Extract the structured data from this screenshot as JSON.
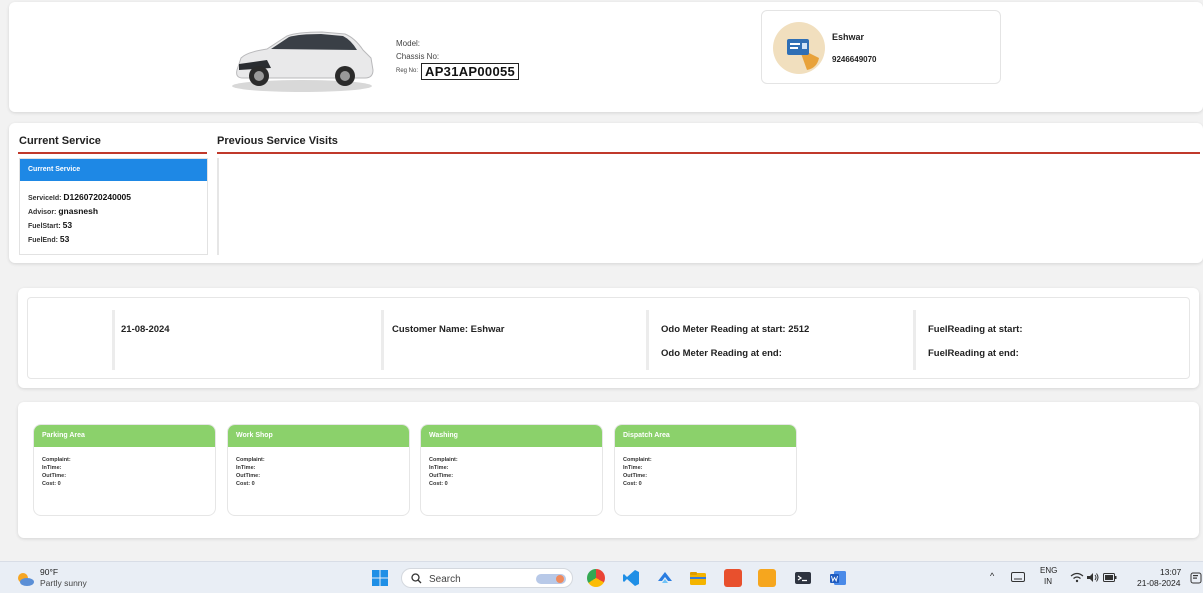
{
  "vehicle": {
    "model_label": "Model:",
    "chassis_label": "Chassis No:",
    "reg_label": "Reg No:",
    "reg_no": "AP31AP00055"
  },
  "customer": {
    "name": "Eshwar",
    "phone": "9246649070"
  },
  "service": {
    "current_title": "Current Service",
    "previous_title": "Previous Service Visits",
    "panel_header": "Current Service",
    "service_id_label": "ServiceId:",
    "service_id": "D1260720240005",
    "advisor_label": "Advisor:",
    "advisor": "gnasnesh",
    "fuel_start_label": "FuelStart:",
    "fuel_start": "53",
    "fuel_end_label": "FuelEnd:",
    "fuel_end": "53"
  },
  "summary": {
    "date": "21-08-2024",
    "customer_name": "Customer Name: Eshwar",
    "odo_start": "Odo Meter Reading at start: 2512",
    "odo_end": "Odo Meter Reading at end:",
    "fuel_start": "FuelReading at start:",
    "fuel_end": "FuelReading at end:"
  },
  "stages": [
    {
      "title": "Parking Area",
      "complaint": "Complaint:",
      "in_time": "InTime:",
      "out_time": "OutTime:",
      "cost": "Cost: 0"
    },
    {
      "title": "Work Shop",
      "complaint": "Complaint:",
      "in_time": "InTime:",
      "out_time": "OutTime:",
      "cost": "Cost: 0"
    },
    {
      "title": "Washing",
      "complaint": "Complaint:",
      "in_time": "InTime:",
      "out_time": "OutTime:",
      "cost": "Cost: 0"
    },
    {
      "title": "Dispatch Area",
      "complaint": "Complaint:",
      "in_time": "InTime:",
      "out_time": "OutTime:",
      "cost": "Cost: 0"
    }
  ],
  "taskbar": {
    "weather_temp": "90°F",
    "weather_desc": "Partly sunny",
    "search_label": "Search",
    "lang_top": "ENG",
    "lang_bottom": "IN",
    "time": "13:07",
    "date": "21-08-2024"
  },
  "colors": {
    "accent_red": "#c0392b",
    "current_blue": "#1e88e5",
    "stage_green": "#8bd16b"
  }
}
